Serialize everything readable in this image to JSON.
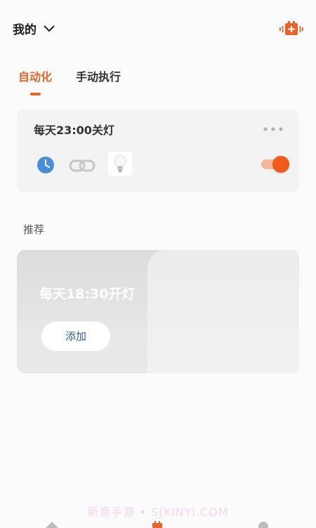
{
  "header": {
    "home_title": "我的"
  },
  "tabs": {
    "automation": "自动化",
    "manual": "手动执行"
  },
  "automation_card": {
    "title": "每天23:00关灯",
    "enabled": true
  },
  "recommend": {
    "section_label": "推荐",
    "title": "每天18:30开灯",
    "add_label": "添加"
  },
  "watermark": "新意手游 • SJXINYI.COM",
  "colors": {
    "accent": "#e2662b",
    "toggle_on": "#f05a1d",
    "clock_blue": "#4a8fd6"
  },
  "icons": [
    "chevron-down-icon",
    "add-device-icon",
    "more-icon",
    "clock-icon",
    "link-icon",
    "bulb-icon"
  ]
}
